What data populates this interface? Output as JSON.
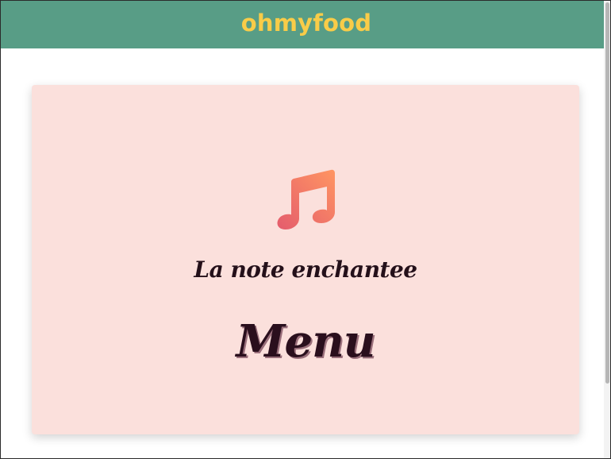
{
  "header": {
    "logo": "ohmyfood"
  },
  "colors": {
    "header_bg": "#589d86",
    "logo": "#f9cc48",
    "card_bg": "#fbe0dc",
    "icon_gradient_start": "#e45c6d",
    "icon_gradient_end": "#ff9562",
    "text": "#24101a"
  },
  "card": {
    "icon": "music-note-icon",
    "restaurant_name": "La note enchantee",
    "title": "Menu"
  }
}
